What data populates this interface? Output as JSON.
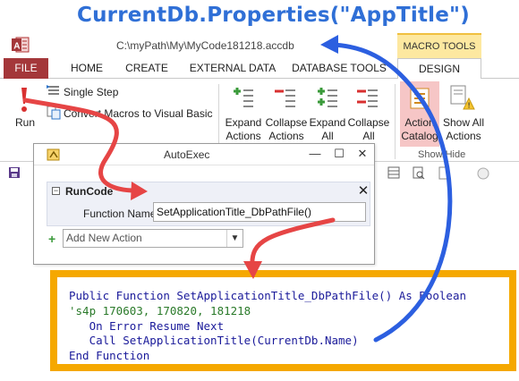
{
  "banner": {
    "text": "CurrentDb.Properties(\"AppTitle\")"
  },
  "window": {
    "title": "C:\\myPath\\My\\MyCode181218.accdb",
    "contextual_tab_group": "MACRO TOOLS"
  },
  "ribbon_tabs": [
    {
      "label": "FILE"
    },
    {
      "label": "HOME"
    },
    {
      "label": "CREATE"
    },
    {
      "label": "EXTERNAL DATA"
    },
    {
      "label": "DATABASE TOOLS"
    },
    {
      "label": "DESIGN"
    }
  ],
  "ribbon": {
    "run_label": "Run",
    "single_step_label": "Single Step",
    "convert_label": "Convert Macros to Visual Basic",
    "expand_actions": [
      "Expand",
      "Actions"
    ],
    "collapse_actions": [
      "Collapse",
      "Actions"
    ],
    "expand_all": [
      "Expand",
      "All"
    ],
    "collapse_all": [
      "Collapse",
      "All"
    ],
    "action_catalog": [
      "Action",
      "Catalog"
    ],
    "show_all_actions": [
      "Show All",
      "Actions"
    ],
    "group_show_hide": "Show/Hide"
  },
  "autoexec": {
    "title": "AutoExec",
    "block_name": "RunCode",
    "function_name_label": "Function Name",
    "function_name_value": "SetApplicationTitle_DbPathFile()",
    "add_action_placeholder": "Add New Action"
  },
  "code": {
    "lines": [
      "Public Function SetApplicationTitle_DbPathFile() As Boolean",
      "'s4p 170603, 170820, 181218",
      "   On Error Resume Next",
      "   Call SetApplicationTitle(CurrentDb.Name)",
      "End Function"
    ]
  },
  "colors": {
    "banner_text": "#2f6fd6",
    "file_tab": "#a4373a",
    "code_frame": "#f5a800",
    "red_arrow": "#e64545",
    "blue_arrow": "#2c5fe0"
  }
}
